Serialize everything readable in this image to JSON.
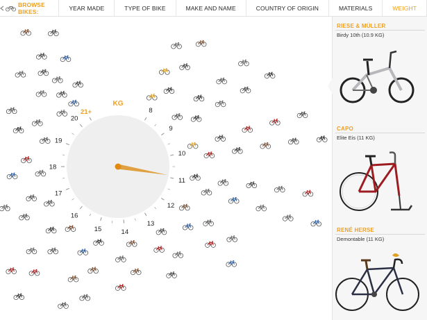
{
  "nav": {
    "back_icon": "back-arrow-bike-icon",
    "browse_label": "BROWSE BIKES:",
    "items": [
      {
        "label": "YEAR MADE",
        "active": false
      },
      {
        "label": "TYPE OF BIKE",
        "active": false
      },
      {
        "label": "MAKE AND NAME",
        "active": false
      },
      {
        "label": "COUNTRY OF ORIGIN",
        "active": false
      },
      {
        "label": "MATERIALS",
        "active": false
      },
      {
        "label": "WEIGHT",
        "active": true
      }
    ]
  },
  "dial": {
    "unit": "KG",
    "hand_value_kg": 10.9,
    "weights": [
      {
        "label": "8",
        "value": 8
      },
      {
        "label": "9",
        "value": 9
      },
      {
        "label": "10",
        "value": 10
      },
      {
        "label": "11",
        "value": 11
      },
      {
        "label": "12",
        "value": 12
      },
      {
        "label": "13",
        "value": 13
      },
      {
        "label": "14",
        "value": 14
      },
      {
        "label": "15",
        "value": 15
      },
      {
        "label": "16",
        "value": 16
      },
      {
        "label": "17",
        "value": 17
      },
      {
        "label": "18",
        "value": 18
      },
      {
        "label": "19",
        "value": 19
      },
      {
        "label": "20",
        "value": 20
      },
      {
        "label": "21+",
        "value": 21
      }
    ],
    "bike_counts": [
      6,
      8,
      13,
      15,
      6,
      4,
      4,
      6,
      7,
      5,
      5,
      5,
      5,
      11
    ],
    "highlight_color": "#f0a020",
    "face_color": "#efefef"
  },
  "details": [
    {
      "brand": "RIESE & MÜLLER",
      "model": "Birdy 10th (10.9 KG)",
      "style": "folding",
      "frame_color": "#b8b8bc"
    },
    {
      "brand": "CAPO",
      "model": "Elite Eis (11 KG)",
      "style": "ice",
      "frame_color": "#9c1c22"
    },
    {
      "brand": "RENÉ HERSE",
      "model": "Demontable (11 KG)",
      "style": "randonneur",
      "frame_color": "#2a2f44"
    }
  ]
}
